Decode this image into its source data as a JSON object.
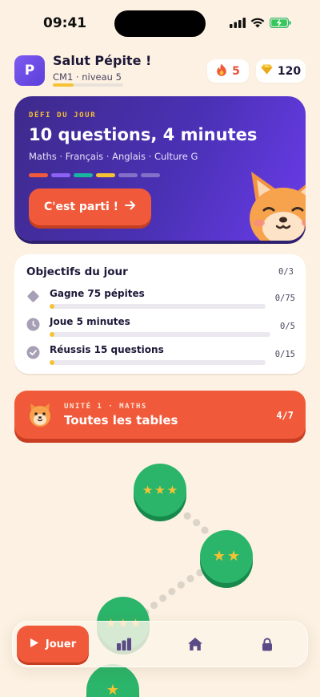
{
  "status_bar": {
    "time": "09:41",
    "icons": [
      "signal-icon",
      "wifi-icon",
      "battery-charging-icon"
    ]
  },
  "header": {
    "avatar_letter": "P",
    "greeting": "Salut Pépite !",
    "level": "CM1 · niveau 5",
    "xp_progress": 0.3,
    "streak": {
      "icon": "flame-icon",
      "value": "5"
    },
    "gems": {
      "icon": "gem-icon",
      "value": "120"
    }
  },
  "challenge": {
    "eyebrow": "DÉFI DU JOUR",
    "title": "10 questions, 4 minutes",
    "subjects": "Maths · Français · Anglais · Culture G",
    "segment_colors": [
      "#F05A3A",
      "#8C62F5",
      "#19B5A0",
      "#F6C234",
      "#8370C9",
      "#8370C9"
    ],
    "cta": "C'est parti !",
    "cta_icon": "arrow-right-icon",
    "mascot": "fox-mascot"
  },
  "objectives": {
    "title": "Objectifs du jour",
    "count": "0/3",
    "items": [
      {
        "icon": "diamond-icon",
        "label": "Gagne 75 pépites",
        "value": "0/75",
        "progress": 0
      },
      {
        "icon": "clock-icon",
        "label": "Joue 5 minutes",
        "value": "0/5",
        "progress": 0
      },
      {
        "icon": "check-icon",
        "label": "Réussis 15 questions",
        "value": "0/15",
        "progress": 0
      }
    ]
  },
  "unit": {
    "eyebrow": "UNITÉ 1 · MATHS",
    "title": "Toutes les tables",
    "progress": "4/7",
    "icon": "fox-face-icon"
  },
  "path": {
    "nodes": [
      {
        "stars": 3,
        "state": "completed"
      },
      {
        "stars": 2,
        "state": "completed"
      },
      {
        "stars": 3,
        "state": "completed"
      },
      {
        "stars": 1,
        "state": "completed"
      }
    ]
  },
  "bottom_nav": {
    "play_label": "Jouer",
    "play_icon": "play-icon",
    "items": [
      "stats-icon",
      "home-icon",
      "lock-icon"
    ]
  },
  "colors": {
    "background": "#FCF1E2",
    "accent_orange": "#F05A3A",
    "challenge_purple": "#4A31B5",
    "gold": "#F6C234",
    "green": "#2BB56A"
  }
}
